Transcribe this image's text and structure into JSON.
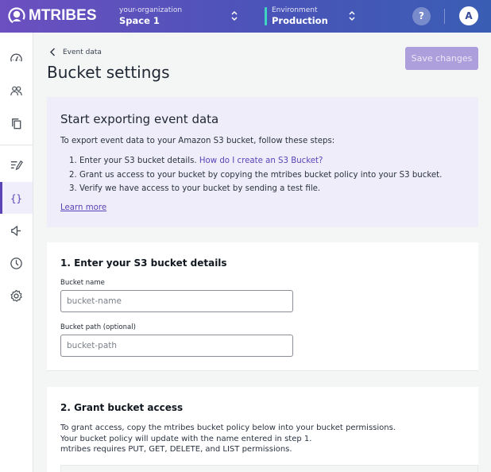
{
  "topbar": {
    "brand": "MTRIBES",
    "organization": {
      "label": "your-organization",
      "value": "Space 1"
    },
    "environment": {
      "label": "Environment",
      "value": "Production",
      "accent": "#3ed6c0"
    },
    "help_label": "?",
    "avatar_initial": "A"
  },
  "sidebar": {
    "items": [
      {
        "icon": "dashboard-gauge-icon",
        "active": false
      },
      {
        "icon": "users-icon",
        "active": false
      },
      {
        "icon": "copy-collections-icon",
        "active": false
      },
      {
        "icon": "edit-list-icon",
        "active": false
      },
      {
        "icon": "braces-code-icon",
        "active": true
      },
      {
        "icon": "megaphone-icon",
        "active": false
      },
      {
        "icon": "clock-history-icon",
        "active": false
      },
      {
        "icon": "gear-settings-icon",
        "active": false
      }
    ]
  },
  "header": {
    "breadcrumb_back": "Event data",
    "title": "Bucket settings",
    "save_label": "Save  changes"
  },
  "intro": {
    "title": "Start exporting event data",
    "lead": "To export event data to your Amazon S3 bucket, follow these steps:",
    "steps": [
      {
        "text": "1. Enter your S3 bucket details. ",
        "link": "How do I create an S3 Bucket?"
      },
      {
        "text": "2. Grant us access to your bucket by copying the mtribes bucket policy into your S3 bucket."
      },
      {
        "text": "3. Verify we have access to your bucket by sending a test file."
      }
    ],
    "learn_more": "Learn more"
  },
  "step1": {
    "title": "1. Enter your S3 bucket details",
    "bucket_name": {
      "label": "Bucket name",
      "placeholder": "bucket-name",
      "value": ""
    },
    "bucket_path": {
      "label": "Bucket path (optional)",
      "placeholder": "bucket-path",
      "value": ""
    }
  },
  "step2": {
    "title": "2. Grant bucket access",
    "lines": [
      "To grant access, copy the mtribes bucket policy below into your bucket permissions.",
      "Your bucket policy will update with the name entered in step 1.",
      "mtribes requires PUT, GET, DELETE, and LIST permissions."
    ]
  },
  "colors": {
    "brand_primary": "#5b43b8",
    "save_disabled": "#ad9fdb",
    "intro_bg": "#efedf9"
  }
}
